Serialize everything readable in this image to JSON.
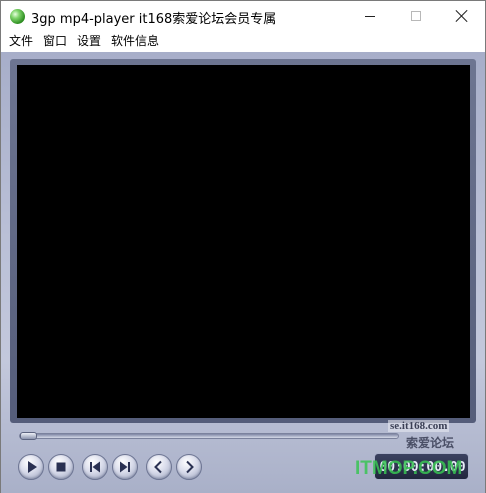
{
  "window": {
    "title": "3gp mp4-player it168索爱论坛会员专属"
  },
  "menu": {
    "items": [
      "文件",
      "窗口",
      "设置",
      "软件信息"
    ]
  },
  "player": {
    "time_display": "00:00:00.00",
    "seek_progress": 0.0,
    "controls": [
      "play",
      "stop",
      "previous",
      "next",
      "rewind",
      "forward"
    ]
  },
  "watermark": {
    "site_url": "se.it168.com",
    "site_name": "索爱论坛",
    "logo_text": "ITMOP.COM"
  },
  "colors": {
    "video_background": "#000000",
    "player_panel": "#b9bfd6",
    "logo_green": "#38c454"
  }
}
